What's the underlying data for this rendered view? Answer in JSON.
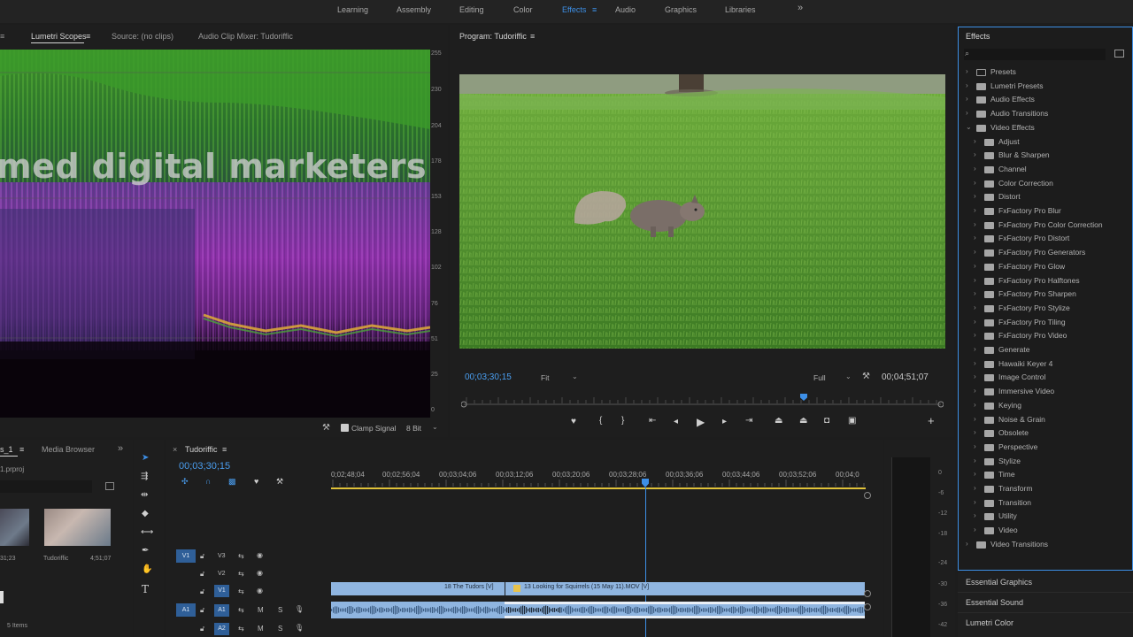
{
  "workspaces": {
    "items": [
      {
        "label": "Learning"
      },
      {
        "label": "Assembly"
      },
      {
        "label": "Editing"
      },
      {
        "label": "Color"
      },
      {
        "label": "Effects"
      },
      {
        "label": "Audio"
      },
      {
        "label": "Graphics"
      },
      {
        "label": "Libraries"
      }
    ],
    "more": "»",
    "active_color": "#3d8fe6"
  },
  "source_panel": {
    "tabs": [
      "Lumetri Scopes",
      "Source: (no clips)",
      "Audio Clip Mixer: Tudoriffic"
    ],
    "overlay_text": "med digital marketers",
    "scale": [
      "255",
      "230",
      "204",
      "178",
      "153",
      "128",
      "102",
      "76",
      "51",
      "25",
      "0"
    ],
    "clamp_signal": "Clamp Signal",
    "bit_depth": "8 Bit"
  },
  "program": {
    "title": "Program: Tudoriffic",
    "timecode_current": "00;03;30;15",
    "fit": "Fit",
    "quality": "Full",
    "timecode_duration": "00;04;51;07",
    "playhead_fraction": 0.71
  },
  "project": {
    "tabs": [
      "s_1",
      "Media Browser"
    ],
    "file": "1.prproj",
    "clips": [
      {
        "name": "",
        "duration": "31;23"
      },
      {
        "name": "Tudoriffic",
        "duration": "4;51;07"
      }
    ],
    "count": "5 Items"
  },
  "timeline": {
    "tab": "Tudoriffic",
    "timecode": "00;03;30;15",
    "ruler": [
      "0;02;48;04",
      "00;02;56;04",
      "00;03;04;06",
      "00;03;12;06",
      "00;03;20;06",
      "00;03;28;06",
      "00;03;36;06",
      "00;03;44;06",
      "00;03;52;06",
      "00;04;0"
    ],
    "tracks": [
      {
        "src": "V1",
        "name": "V3"
      },
      {
        "name": "V2"
      },
      {
        "name": "V1"
      },
      {
        "src": "A1",
        "name": "A1"
      },
      {
        "name": "A2"
      }
    ],
    "clips": [
      {
        "label": "18  The Tudors [V]"
      },
      {
        "label": "13  Looking for Squirrels (15 May 11).MOV [V]"
      }
    ]
  },
  "meter": {
    "scale": [
      "0",
      "-6",
      "-12",
      "-18",
      "-24",
      "-30",
      "-36",
      "-42"
    ]
  },
  "effects": {
    "title": "Effects",
    "search_placeholder": "",
    "tree": [
      {
        "label": "Presets",
        "level": 0
      },
      {
        "label": "Lumetri Presets",
        "level": 0
      },
      {
        "label": "Audio Effects",
        "level": 0
      },
      {
        "label": "Audio Transitions",
        "level": 0
      },
      {
        "label": "Video Effects",
        "level": 0,
        "expanded": true
      },
      {
        "label": "Adjust",
        "level": 1
      },
      {
        "label": "Blur & Sharpen",
        "level": 1
      },
      {
        "label": "Channel",
        "level": 1
      },
      {
        "label": "Color Correction",
        "level": 1
      },
      {
        "label": "Distort",
        "level": 1
      },
      {
        "label": "FxFactory Pro Blur",
        "level": 1
      },
      {
        "label": "FxFactory Pro Color Correction",
        "level": 1
      },
      {
        "label": "FxFactory Pro Distort",
        "level": 1
      },
      {
        "label": "FxFactory Pro Generators",
        "level": 1
      },
      {
        "label": "FxFactory Pro Glow",
        "level": 1
      },
      {
        "label": "FxFactory Pro Halftones",
        "level": 1
      },
      {
        "label": "FxFactory Pro Sharpen",
        "level": 1
      },
      {
        "label": "FxFactory Pro Stylize",
        "level": 1
      },
      {
        "label": "FxFactory Pro Tiling",
        "level": 1
      },
      {
        "label": "FxFactory Pro Video",
        "level": 1
      },
      {
        "label": "Generate",
        "level": 1
      },
      {
        "label": "Hawaiki Keyer 4",
        "level": 1
      },
      {
        "label": "Image Control",
        "level": 1
      },
      {
        "label": "Immersive Video",
        "level": 1
      },
      {
        "label": "Keying",
        "level": 1
      },
      {
        "label": "Noise & Grain",
        "level": 1
      },
      {
        "label": "Obsolete",
        "level": 1
      },
      {
        "label": "Perspective",
        "level": 1
      },
      {
        "label": "Stylize",
        "level": 1
      },
      {
        "label": "Time",
        "level": 1
      },
      {
        "label": "Transform",
        "level": 1
      },
      {
        "label": "Transition",
        "level": 1
      },
      {
        "label": "Utility",
        "level": 1
      },
      {
        "label": "Video",
        "level": 1
      },
      {
        "label": "Video Transitions",
        "level": 0
      }
    ],
    "collapsed_panels": [
      "Essential Graphics",
      "Essential Sound",
      "Lumetri Color"
    ]
  }
}
